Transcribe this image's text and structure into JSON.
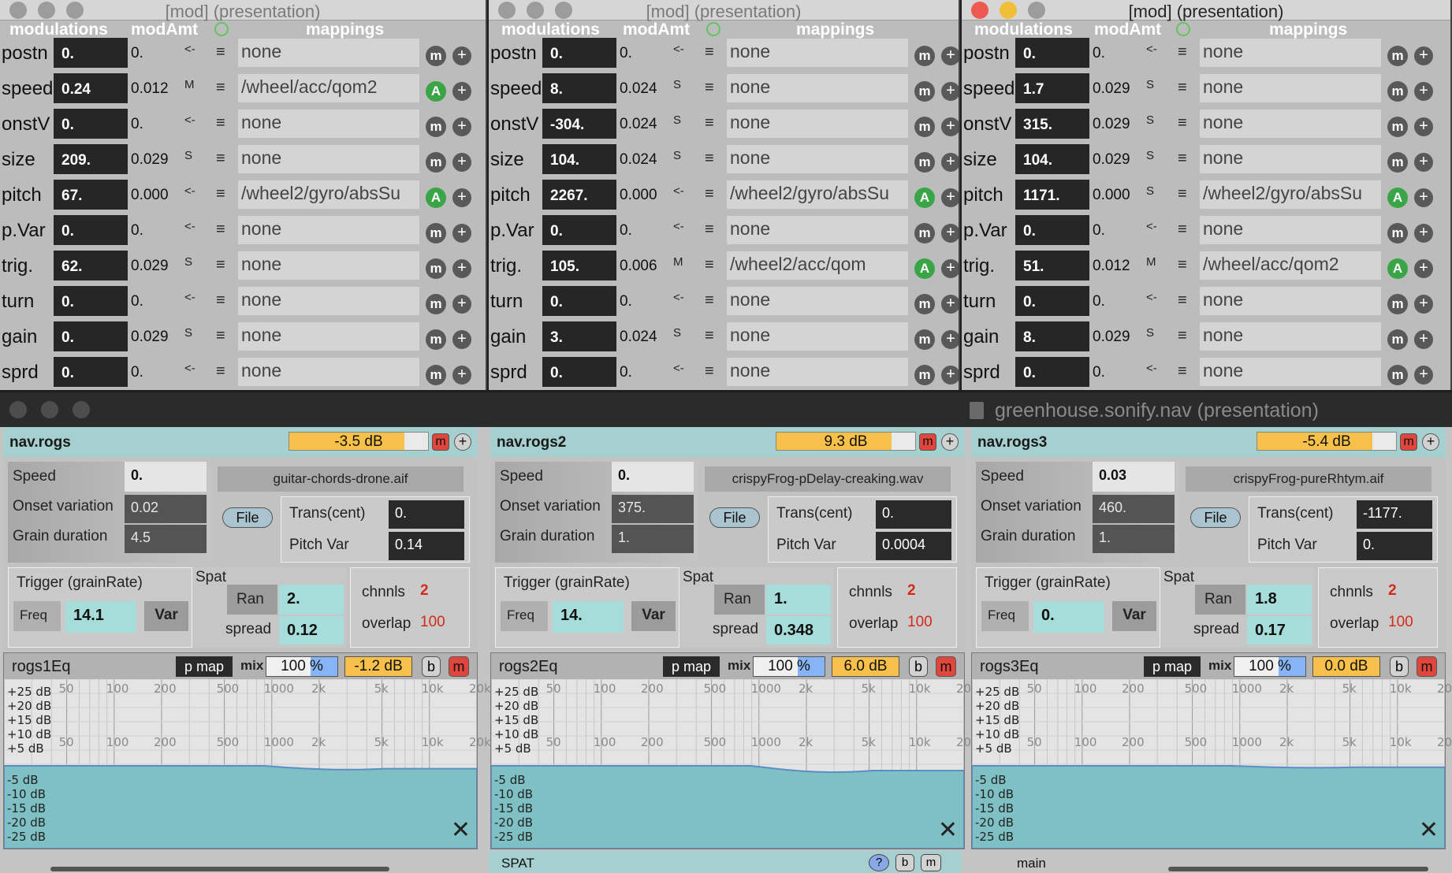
{
  "mod_windows": [
    {
      "title": "[mod] (presentation)",
      "active": false,
      "headers": {
        "modulations": "modulations",
        "modAmt": "modAmt",
        "mappings": "mappings"
      },
      "rows": [
        {
          "label": "postn",
          "value": "0.",
          "amt": "0.",
          "sym": "<-",
          "mapping": "none",
          "btn": "m"
        },
        {
          "label": "speed",
          "value": "0.24",
          "amt": "0.012",
          "sym": "M",
          "mapping": "/wheel/acc/qom2",
          "btn": "A"
        },
        {
          "label": "onstV",
          "value": "0.",
          "amt": "0.",
          "sym": "<-",
          "mapping": "none",
          "btn": "m"
        },
        {
          "label": "size",
          "value": "209.",
          "amt": "0.029",
          "sym": "S",
          "mapping": "none",
          "btn": "m"
        },
        {
          "label": "pitch",
          "value": "67.",
          "amt": "0.000",
          "sym": "<-",
          "mapping": "/wheel2/gyro/absSu",
          "btn": "A"
        },
        {
          "label": "p.Var",
          "value": "0.",
          "amt": "0.",
          "sym": "<-",
          "mapping": "none",
          "btn": "m"
        },
        {
          "label": "trig.",
          "value": "62.",
          "amt": "0.029",
          "sym": "S",
          "mapping": "none",
          "btn": "m"
        },
        {
          "label": "turn",
          "value": "0.",
          "amt": "0.",
          "sym": "<-",
          "mapping": "none",
          "btn": "m"
        },
        {
          "label": "gain",
          "value": "0.",
          "amt": "0.029",
          "sym": "S",
          "mapping": "none",
          "btn": "m"
        },
        {
          "label": "sprd",
          "value": "0.",
          "amt": "0.",
          "sym": "<-",
          "mapping": "none",
          "btn": "m"
        }
      ]
    },
    {
      "title": "[mod] (presentation)",
      "active": false,
      "headers": {
        "modulations": "modulations",
        "modAmt": "modAmt",
        "mappings": "mappings"
      },
      "rows": [
        {
          "label": "postn",
          "value": "0.",
          "amt": "0.",
          "sym": "<-",
          "mapping": "none",
          "btn": "m"
        },
        {
          "label": "speed",
          "value": "8.",
          "amt": "0.024",
          "sym": "S",
          "mapping": "none",
          "btn": "m"
        },
        {
          "label": "onstV",
          "value": "-304.",
          "amt": "0.024",
          "sym": "S",
          "mapping": "none",
          "btn": "m"
        },
        {
          "label": "size",
          "value": "104.",
          "amt": "0.024",
          "sym": "S",
          "mapping": "none",
          "btn": "m"
        },
        {
          "label": "pitch",
          "value": "2267.",
          "amt": "0.000",
          "sym": "<-",
          "mapping": "/wheel2/gyro/absSu",
          "btn": "A"
        },
        {
          "label": "p.Var",
          "value": "0.",
          "amt": "0.",
          "sym": "<-",
          "mapping": "none",
          "btn": "m"
        },
        {
          "label": "trig.",
          "value": "105.",
          "amt": "0.006",
          "sym": "M",
          "mapping": "/wheel2/acc/qom",
          "btn": "A"
        },
        {
          "label": "turn",
          "value": "0.",
          "amt": "0.",
          "sym": "<-",
          "mapping": "none",
          "btn": "m"
        },
        {
          "label": "gain",
          "value": "3.",
          "amt": "0.024",
          "sym": "S",
          "mapping": "none",
          "btn": "m"
        },
        {
          "label": "sprd",
          "value": "0.",
          "amt": "0.",
          "sym": "<-",
          "mapping": "none",
          "btn": "m"
        }
      ]
    },
    {
      "title": "[mod] (presentation)",
      "active": true,
      "headers": {
        "modulations": "modulations",
        "modAmt": "modAmt",
        "mappings": "mappings"
      },
      "rows": [
        {
          "label": "postn",
          "value": "0.",
          "amt": "0.",
          "sym": "<-",
          "mapping": "none",
          "btn": "m"
        },
        {
          "label": "speed",
          "value": "1.7",
          "amt": "0.029",
          "sym": "S",
          "mapping": "none",
          "btn": "m"
        },
        {
          "label": "onstV",
          "value": "315.",
          "amt": "0.029",
          "sym": "S",
          "mapping": "none",
          "btn": "m"
        },
        {
          "label": "size",
          "value": "104.",
          "amt": "0.029",
          "sym": "S",
          "mapping": "none",
          "btn": "m"
        },
        {
          "label": "pitch",
          "value": "1171.",
          "amt": "0.000",
          "sym": "S",
          "mapping": "/wheel2/gyro/absSu",
          "btn": "A"
        },
        {
          "label": "p.Var",
          "value": "0.",
          "amt": "0.",
          "sym": "<-",
          "mapping": "none",
          "btn": "m"
        },
        {
          "label": "trig.",
          "value": "51.",
          "amt": "0.012",
          "sym": "M",
          "mapping": "/wheel/acc/qom2",
          "btn": "A"
        },
        {
          "label": "turn",
          "value": "0.",
          "amt": "0.",
          "sym": "<-",
          "mapping": "none",
          "btn": "m"
        },
        {
          "label": "gain",
          "value": "8.",
          "amt": "0.029",
          "sym": "S",
          "mapping": "none",
          "btn": "m"
        },
        {
          "label": "sprd",
          "value": "0.",
          "amt": "0.",
          "sym": "<-",
          "mapping": "none",
          "btn": "m"
        }
      ]
    }
  ],
  "main_window": {
    "title": "greenhouse.sonify.nav (presentation)"
  },
  "modules": [
    {
      "name": "nav.rogs",
      "db": "-3.5 dB",
      "file": "guitar-chords-drone.aif",
      "speed_label": "Speed",
      "speed": "0.",
      "onset_label": "Onset variation",
      "onset": "0.02",
      "grain_label": "Grain duration",
      "grain": "4.5",
      "file_btn": "File",
      "trans_label": "Trans(cent)",
      "trans": "0.",
      "pitchvar_label": "Pitch Var",
      "pitchvar": "0.14",
      "trigger_label": "Trigger (grainRate)",
      "freq_label": "Freq",
      "freq": "14.1",
      "var_label": "Var",
      "spat_label": "Spat",
      "ran_label": "Ran",
      "ran": "2.",
      "spread_label": "spread",
      "spread": "0.12",
      "chnnls_label": "chnnls",
      "chnnls": "2",
      "overlap_label": "overlap",
      "overlap": "100",
      "eq": {
        "name": "rogs1Eq",
        "pmap": "p map",
        "mix": "mix",
        "pct": "100 %",
        "gain": "-1.2 dB",
        "b": "b",
        "m": "m"
      }
    },
    {
      "name": "nav.rogs2",
      "db": "9.3 dB",
      "file": "crispyFrog-pDelay-creaking.wav",
      "speed_label": "Speed",
      "speed": "0.",
      "onset_label": "Onset variation",
      "onset": "375.",
      "grain_label": "Grain duration",
      "grain": "1.",
      "file_btn": "File",
      "trans_label": "Trans(cent)",
      "trans": "0.",
      "pitchvar_label": "Pitch Var",
      "pitchvar": "0.0004",
      "trigger_label": "Trigger (grainRate)",
      "freq_label": "Freq",
      "freq": "14.",
      "var_label": "Var",
      "spat_label": "Spat",
      "ran_label": "Ran",
      "ran": "1.",
      "spread_label": "spread",
      "spread": "0.348",
      "chnnls_label": "chnnls",
      "chnnls": "2",
      "overlap_label": "overlap",
      "overlap": "100",
      "eq": {
        "name": "rogs2Eq",
        "pmap": "p map",
        "mix": "mix",
        "pct": "100 %",
        "gain": "6.0 dB",
        "b": "b",
        "m": "m"
      }
    },
    {
      "name": "nav.rogs3",
      "db": "-5.4 dB",
      "file": "crispyFrog-pureRhtym.aif",
      "speed_label": "Speed",
      "speed": "0.03",
      "onset_label": "Onset variation",
      "onset": "460.",
      "grain_label": "Grain duration",
      "grain": "1.",
      "file_btn": "File",
      "trans_label": "Trans(cent)",
      "trans": "-1177.",
      "pitchvar_label": "Pitch Var",
      "pitchvar": "0.",
      "trigger_label": "Trigger (grainRate)",
      "freq_label": "Freq",
      "freq": "0.",
      "var_label": "Var",
      "spat_label": "Spat",
      "ran_label": "Ran",
      "ran": "1.8",
      "spread_label": "spread",
      "spread": "0.17",
      "chnnls_label": "chnnls",
      "chnnls": "2",
      "overlap_label": "overlap",
      "overlap": "100",
      "eq": {
        "name": "rogs3Eq",
        "pmap": "p map",
        "mix": "mix",
        "pct": "100 %",
        "gain": "0.0 dB",
        "b": "b",
        "m": "m"
      }
    }
  ],
  "eq_axis": {
    "freq_top": [
      "50",
      "100",
      "200",
      "500",
      "1000",
      "2k",
      "5k",
      "10k",
      "20k"
    ],
    "freq_mid": [
      "50",
      "100",
      "200",
      "500",
      "1000",
      "2k",
      "5k",
      "10k",
      "20k"
    ],
    "db_pos": [
      "+25 dB",
      "+20 dB",
      "+15 dB",
      "+10 dB",
      "+5 dB"
    ],
    "db_neg": [
      "-5 dB",
      "-10 dB",
      "-15 dB",
      "-20 dB",
      "-25 dB"
    ]
  },
  "footer": {
    "spat": "SPAT",
    "help": "?",
    "b": "b",
    "m": "m",
    "main": "main"
  },
  "colors": {
    "teal": "#a6dcd9",
    "orange": "#f7c04a",
    "red": "#e0463b",
    "green": "#3aa547"
  }
}
